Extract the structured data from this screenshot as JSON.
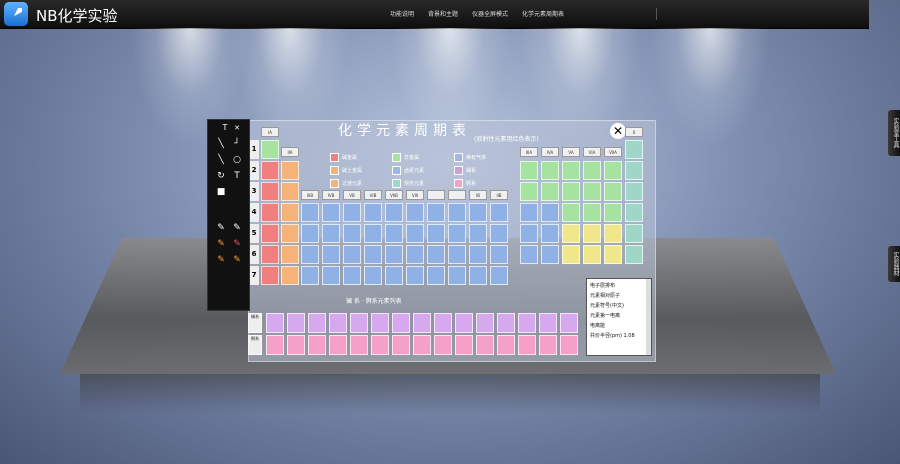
{
  "app": {
    "title": "NB化学实验",
    "icon": "rocket-icon"
  },
  "topmenu": [
    "功能说明",
    "背景和主题",
    "仪器全屏模式",
    "化学元素周期表"
  ],
  "side_tabs": [
    "实验室工具",
    "实验器材"
  ],
  "periodic": {
    "title": "化学元素周期表",
    "subtitle": "(放射性元素用红色表示)",
    "close_label": "✕",
    "lanthanide_label": "镧 系 · 锕系元素列表",
    "periods": [
      "1",
      "2",
      "3",
      "4",
      "5",
      "6",
      "7"
    ],
    "top_group_headers": [
      "IA",
      "IIA"
    ],
    "right_group_headers": [
      "IIIA",
      "IVA",
      "VA",
      "VIA",
      "VIIA",
      "0"
    ],
    "mid_group_headers": [
      "IIIB",
      "IVB",
      "VB",
      "VIB",
      "VIIB",
      "VIII",
      "",
      "",
      "IB",
      "IIB"
    ],
    "legend": [
      {
        "label": "碱金属",
        "color": "#f27f7f"
      },
      {
        "label": "碱土金属",
        "color": "#f5b37a"
      },
      {
        "label": "过渡元素",
        "color": "#f5b37a"
      },
      {
        "label": "非金属",
        "color": "#a6e3a1"
      },
      {
        "label": "卤素元素",
        "color": "#9fb7e8"
      },
      {
        "label": "惰性元素",
        "color": "#9fd6c8"
      },
      {
        "label": "稀有气体",
        "color": "#9fb7e8"
      },
      {
        "label": "镧系",
        "color": "#c9a0e6"
      },
      {
        "label": "锕系",
        "color": "#f5a0c8"
      }
    ],
    "row_labels_f": [
      "镧系",
      "锕系"
    ]
  },
  "toolbox": {
    "title": "T",
    "close": "✕",
    "tools": [
      "line-tool",
      "corner-tool",
      "line-small-tool",
      "circle-tool",
      "rotate-tool",
      "text-tool",
      "rect-tool",
      "pen-tool",
      "brush-tool",
      "pencil-tool",
      "eraser-tool",
      "highlighter-tool",
      "marker-tool"
    ]
  },
  "infobox": {
    "lines": [
      "电子层排布",
      "元素相对原子",
      "元素符号(中文)",
      "元素第一电离",
      "电离能",
      "共价半径(pm) 1.08"
    ]
  }
}
